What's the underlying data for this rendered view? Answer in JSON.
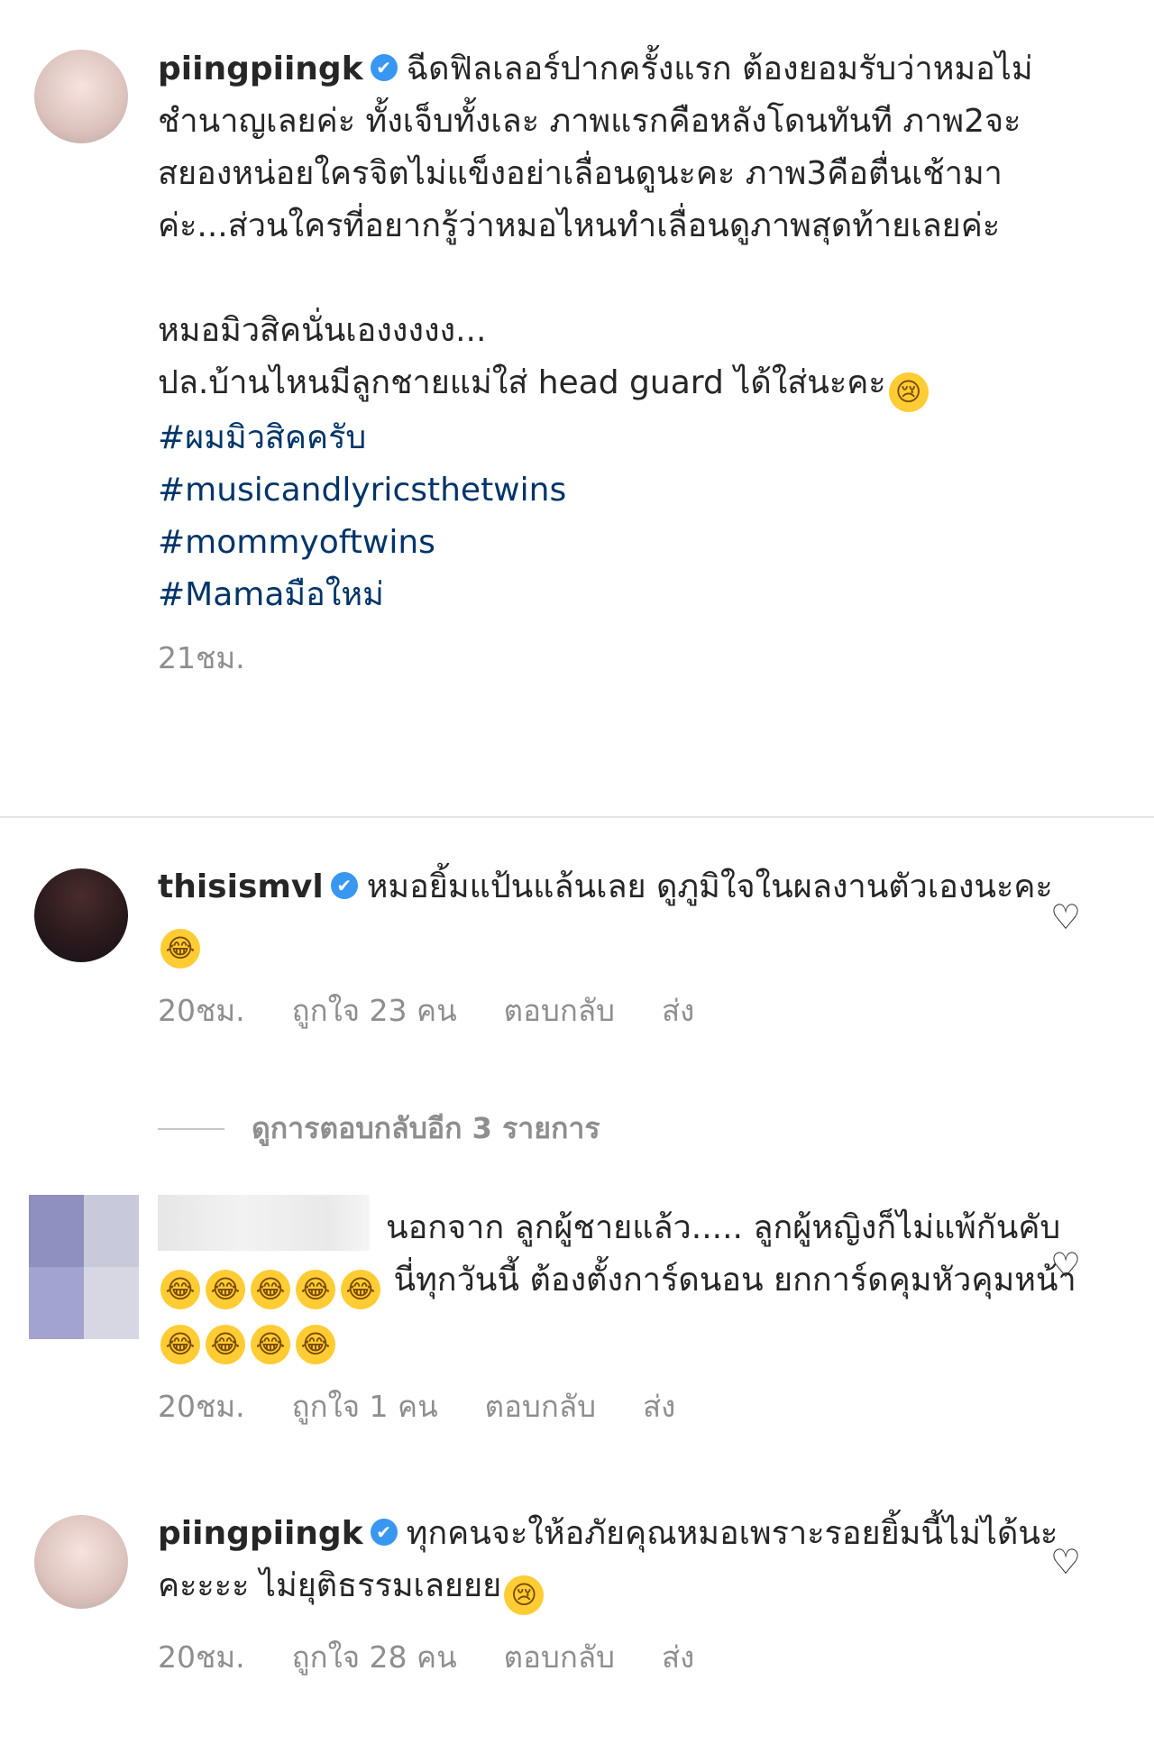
{
  "post": {
    "username": "piingpiingk",
    "caption_lines": [
      "ฉีดฟิลเลอร์ปากครั้งแรก ต้องยอมรับว่าหมอไม่ชำนาญเลยค่ะ ทั้งเจ็บทั้งเละ ภาพแรกคือหลังโดนทันที ภาพ2จะสยองหน่อยใครจิตไม่แข็งอย่าเลื่อนดูนะคะ ภาพ3คือตื่นเช้ามาค่ะ...ส่วนใครที่อยากรู้ว่าหมอไหนทำเลื่อนดูภาพสุดท้ายเลยค่ะ"
    ],
    "caption_line2": "หมอมิวสิคนั่นเองงงงง...",
    "caption_line3": "ปล.บ้านไหนมีลูกชายแม่ใส่ head guard ได้ใส่นะคะ",
    "hashtags": [
      "#ผมมิวสิคครับ",
      "#musicandlyricsthetwins",
      "#mommyoftwins",
      "#Mamaมือใหม่"
    ],
    "time": "21ชม."
  },
  "comments": [
    {
      "username": "thisismvl",
      "text": "หมอยิ้มแป้นแล้นเลย ดูภูมิใจในผลงานตัวเองนะคะ",
      "time": "20ชม.",
      "likes": "ถูกใจ 23 คน",
      "reply": "ตอบกลับ",
      "send": "ส่ง"
    },
    {
      "username": "",
      "text_a": "นอกจาก ลูกผู้ชายแล้ว..... ลูกผู้หญิงก็ไม่แพ้กันคับ",
      "text_b": "นี่ทุกวันนี้ ต้องตั้งการ์ดนอน ยกการ์ดคุมหัวคุมหน้า",
      "time": "20ชม.",
      "likes": "ถูกใจ 1 คน",
      "reply": "ตอบกลับ",
      "send": "ส่ง"
    },
    {
      "username": "piingpiingk",
      "text": "ทุกคนจะให้อภัยคุณหมอเพราะรอยยิ้มนี้ไม่ได้นะคะะะะ ไม่ยุติธรรมเลยยย",
      "time": "20ชม.",
      "likes": "ถูกใจ 28 คน",
      "reply": "ตอบกลับ",
      "send": "ส่ง"
    }
  ],
  "view_replies": "ดูการตอบกลับอีก 3 รายการ",
  "icons": {
    "verified": "verified-badge-icon",
    "heart": "heart-outline-icon",
    "emoji_cry": "crying-face-emoji",
    "emoji_laugh": "tears-of-joy-emoji"
  },
  "colors": {
    "hashtag": "#003569",
    "verified": "#3897f0",
    "meta": "#8e8e8e"
  }
}
